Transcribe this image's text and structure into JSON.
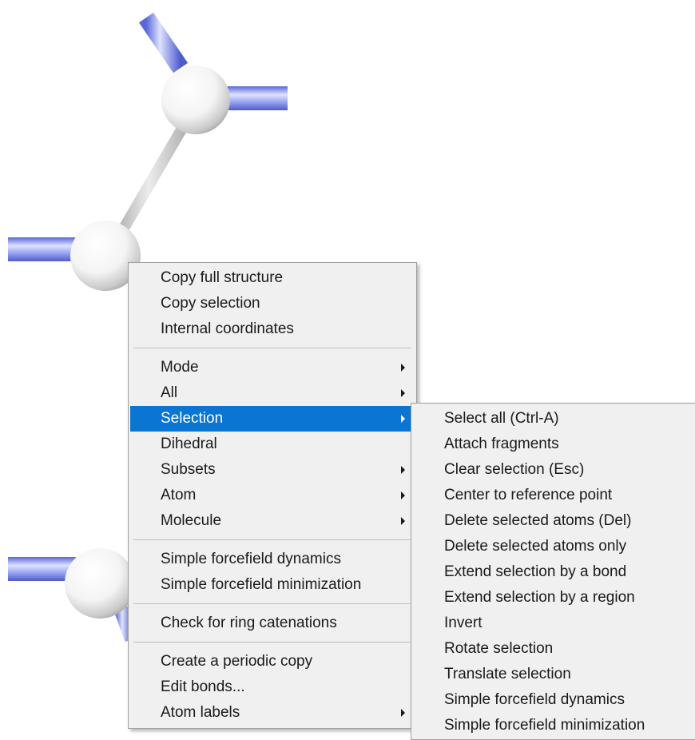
{
  "colors": {
    "menu_background": "#f0f0f0",
    "menu_highlight": "#0a75d2",
    "atom": "#ffffff",
    "bond_blue": "#8f9cf0",
    "bond_grey": "#d4d4d4"
  },
  "main_menu": {
    "groups": [
      [
        {
          "label": "Copy full structure"
        },
        {
          "label": "Copy selection"
        },
        {
          "label": "Internal coordinates"
        }
      ],
      [
        {
          "label": "Mode",
          "submenu": true
        },
        {
          "label": "All",
          "submenu": true
        },
        {
          "label": "Selection",
          "submenu": true,
          "highlighted": true
        },
        {
          "label": "Dihedral"
        },
        {
          "label": "Subsets",
          "submenu": true
        },
        {
          "label": "Atom",
          "submenu": true
        },
        {
          "label": "Molecule",
          "submenu": true
        }
      ],
      [
        {
          "label": "Simple forcefield dynamics"
        },
        {
          "label": "Simple forcefield minimization"
        }
      ],
      [
        {
          "label": "Check for ring catenations"
        }
      ],
      [
        {
          "label": "Create a periodic copy"
        },
        {
          "label": "Edit bonds..."
        },
        {
          "label": "Atom labels",
          "submenu": true
        }
      ]
    ]
  },
  "selection_submenu": {
    "items": [
      "Select all (Ctrl-A)",
      "Attach fragments",
      "Clear selection (Esc)",
      "Center to reference point",
      "Delete selected atoms (Del)",
      "Delete selected atoms only",
      "Extend selection by a bond",
      "Extend selection by a region",
      "Invert",
      "Rotate selection",
      "Translate selection",
      "Simple forcefield dynamics",
      "Simple forcefield minimization"
    ]
  }
}
